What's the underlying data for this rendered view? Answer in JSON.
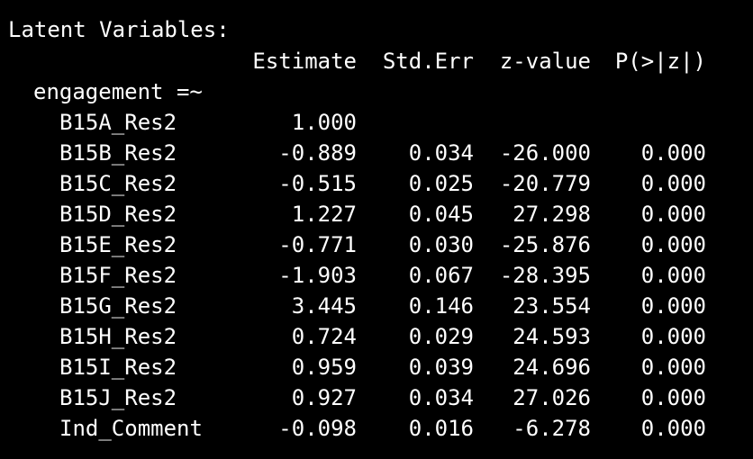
{
  "title": "Latent Variables:",
  "headers": {
    "estimate": "Estimate",
    "std_err": "Std.Err",
    "z_value": "z-value",
    "p_value": "P(>|z|)"
  },
  "group_label": "engagement =~",
  "rows": [
    {
      "name": "B15A_Res2",
      "estimate": "1.000",
      "std_err": "",
      "z_value": "",
      "p_value": ""
    },
    {
      "name": "B15B_Res2",
      "estimate": "-0.889",
      "std_err": "0.034",
      "z_value": "-26.000",
      "p_value": "0.000"
    },
    {
      "name": "B15C_Res2",
      "estimate": "-0.515",
      "std_err": "0.025",
      "z_value": "-20.779",
      "p_value": "0.000"
    },
    {
      "name": "B15D_Res2",
      "estimate": "1.227",
      "std_err": "0.045",
      "z_value": "27.298",
      "p_value": "0.000"
    },
    {
      "name": "B15E_Res2",
      "estimate": "-0.771",
      "std_err": "0.030",
      "z_value": "-25.876",
      "p_value": "0.000"
    },
    {
      "name": "B15F_Res2",
      "estimate": "-1.903",
      "std_err": "0.067",
      "z_value": "-28.395",
      "p_value": "0.000"
    },
    {
      "name": "B15G_Res2",
      "estimate": "3.445",
      "std_err": "0.146",
      "z_value": "23.554",
      "p_value": "0.000"
    },
    {
      "name": "B15H_Res2",
      "estimate": "0.724",
      "std_err": "0.029",
      "z_value": "24.593",
      "p_value": "0.000"
    },
    {
      "name": "B15I_Res2",
      "estimate": "0.959",
      "std_err": "0.039",
      "z_value": "24.696",
      "p_value": "0.000"
    },
    {
      "name": "B15J_Res2",
      "estimate": "0.927",
      "std_err": "0.034",
      "z_value": "27.026",
      "p_value": "0.000"
    },
    {
      "name": "Ind_Comment",
      "estimate": "-0.098",
      "std_err": "0.016",
      "z_value": "-6.278",
      "p_value": "0.000"
    }
  ]
}
